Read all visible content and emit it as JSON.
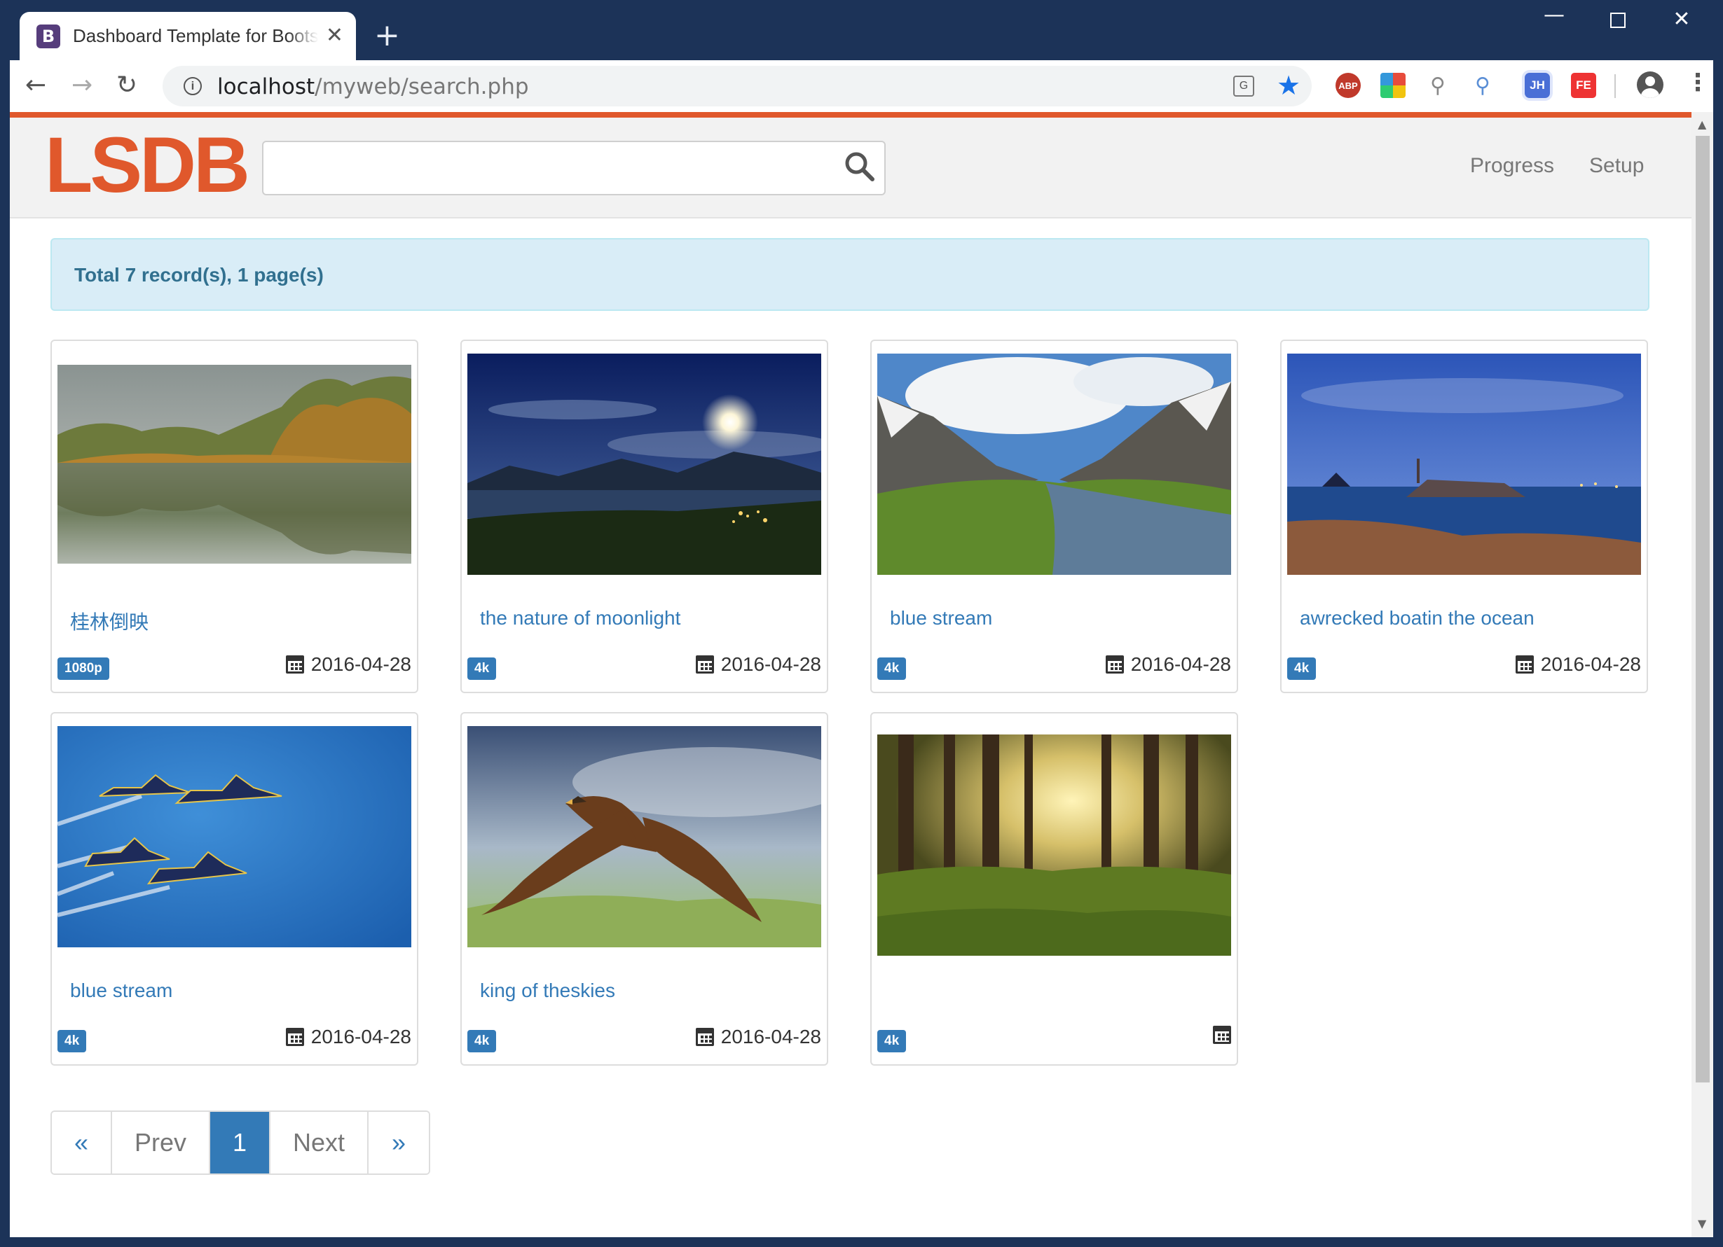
{
  "browser": {
    "tab_title": "Dashboard Template for Bootstrap",
    "tab_favicon": "B",
    "url_host": "localhost",
    "url_path": "/myweb/search.php",
    "extensions": [
      "ABP",
      "JH",
      "FE"
    ],
    "icons": [
      "back-arrow-icon",
      "forward-arrow-icon",
      "reload-icon",
      "info-icon",
      "translate-icon",
      "star-icon",
      "account-icon",
      "menu-icon"
    ]
  },
  "navbar": {
    "brand": "LSDB",
    "search_value": "",
    "links": {
      "progress": "Progress",
      "setup": "Setup"
    }
  },
  "alert": {
    "text": "Total 7 record(s), 1 page(s)"
  },
  "cards": [
    {
      "title": "桂林倒映",
      "badge": "1080p",
      "date": "2016-04-28",
      "image": "lake-autumn-reflection"
    },
    {
      "title": "the nature of moonlight",
      "badge": "4k",
      "date": "2016-04-28",
      "image": "moonlit-town-lake"
    },
    {
      "title": "blue stream",
      "badge": "4k",
      "date": "2016-04-28",
      "image": "mountain-valley-stream"
    },
    {
      "title": "awrecked boatin the ocean",
      "badge": "4k",
      "date": "2016-04-28",
      "image": "shipwreck-night-coast"
    },
    {
      "title": "blue stream",
      "badge": "4k",
      "date": "2016-04-28",
      "image": "jets-formation-sky"
    },
    {
      "title": "king of theskies",
      "badge": "4k",
      "date": "2016-04-28",
      "image": "eagle-in-flight"
    },
    {
      "title": "",
      "badge": "4k",
      "date": "",
      "image": "sunlit-forest"
    }
  ],
  "pagination": {
    "first": "«",
    "prev": "Prev",
    "current": "1",
    "next": "Next",
    "last": "»"
  },
  "colors": {
    "brand": "#e0582c",
    "link": "#337ab7",
    "alert_bg": "#d9edf7",
    "alert_text": "#31708f",
    "chrome": "#1c3358"
  }
}
